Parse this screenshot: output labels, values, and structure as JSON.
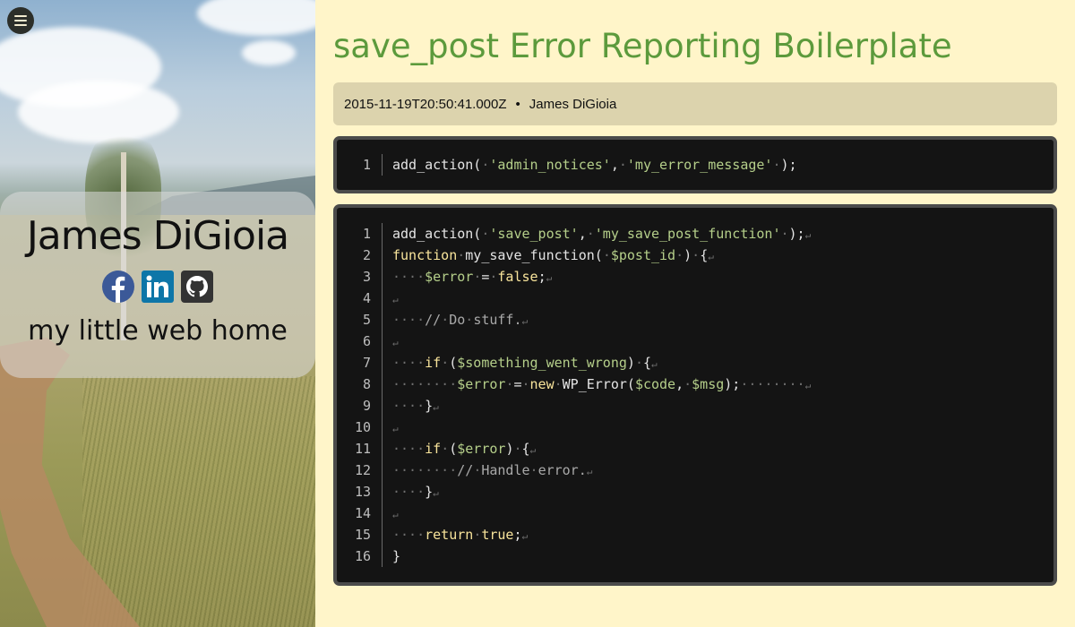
{
  "sidebar": {
    "name": "James DiGioia",
    "tagline": "my little web home",
    "socials": [
      {
        "icon": "facebook-icon",
        "color": "#3b5998"
      },
      {
        "icon": "linkedin-icon",
        "color": "#0e76a8"
      },
      {
        "icon": "github-icon",
        "color": "#333333"
      }
    ]
  },
  "post": {
    "title": "save_post Error Reporting Boilerplate",
    "date": "2015-11-19T20:50:41.000Z",
    "separator": "•",
    "author": "James DiGioia"
  },
  "code_blocks": [
    {
      "lines": [
        {
          "n": "1",
          "tokens": [
            [
              "p",
              "add_action("
            ],
            [
              "ws",
              "·"
            ],
            [
              "str",
              "'admin_notices'"
            ],
            [
              "p",
              ","
            ],
            [
              "ws",
              "·"
            ],
            [
              "str",
              "'my_error_message'"
            ],
            [
              "ws",
              "·"
            ],
            [
              "p",
              ");"
            ]
          ]
        }
      ]
    },
    {
      "lines": [
        {
          "n": "1",
          "tokens": [
            [
              "p",
              "add_action("
            ],
            [
              "ws",
              "·"
            ],
            [
              "str",
              "'save_post'"
            ],
            [
              "p",
              ","
            ],
            [
              "ws",
              "·"
            ],
            [
              "str",
              "'my_save_post_function'"
            ],
            [
              "ws",
              "·"
            ],
            [
              "p",
              ");"
            ],
            [
              "eol",
              "↵"
            ]
          ]
        },
        {
          "n": "2",
          "tokens": [
            [
              "kw",
              "function"
            ],
            [
              "ws",
              "·"
            ],
            [
              "p",
              "my_save_function("
            ],
            [
              "ws",
              "·"
            ],
            [
              "var",
              "$post_id"
            ],
            [
              "ws",
              "·"
            ],
            [
              "p",
              ")"
            ],
            [
              "ws",
              "·"
            ],
            [
              "p",
              "{"
            ],
            [
              "eol",
              "↵"
            ]
          ]
        },
        {
          "n": "3",
          "tokens": [
            [
              "ws",
              "····"
            ],
            [
              "var",
              "$error"
            ],
            [
              "ws",
              "·"
            ],
            [
              "p",
              "="
            ],
            [
              "ws",
              "·"
            ],
            [
              "kw",
              "false"
            ],
            [
              "p",
              ";"
            ],
            [
              "eol",
              "↵"
            ]
          ]
        },
        {
          "n": "4",
          "tokens": [
            [
              "eol",
              "↵"
            ]
          ]
        },
        {
          "n": "5",
          "tokens": [
            [
              "ws",
              "····"
            ],
            [
              "cm",
              "//"
            ],
            [
              "ws",
              "·"
            ],
            [
              "cm",
              "Do"
            ],
            [
              "ws",
              "·"
            ],
            [
              "cm",
              "stuff."
            ],
            [
              "eol",
              "↵"
            ]
          ]
        },
        {
          "n": "6",
          "tokens": [
            [
              "eol",
              "↵"
            ]
          ]
        },
        {
          "n": "7",
          "tokens": [
            [
              "ws",
              "····"
            ],
            [
              "kw",
              "if"
            ],
            [
              "ws",
              "·"
            ],
            [
              "p",
              "("
            ],
            [
              "var",
              "$something_went_wrong"
            ],
            [
              "p",
              ")"
            ],
            [
              "ws",
              "·"
            ],
            [
              "p",
              "{"
            ],
            [
              "eol",
              "↵"
            ]
          ]
        },
        {
          "n": "8",
          "tokens": [
            [
              "ws",
              "········"
            ],
            [
              "var",
              "$error"
            ],
            [
              "ws",
              "·"
            ],
            [
              "p",
              "="
            ],
            [
              "ws",
              "·"
            ],
            [
              "kw",
              "new"
            ],
            [
              "ws",
              "·"
            ],
            [
              "p",
              "WP_Error("
            ],
            [
              "var",
              "$code"
            ],
            [
              "p",
              ","
            ],
            [
              "ws",
              "·"
            ],
            [
              "var",
              "$msg"
            ],
            [
              "p",
              ");"
            ],
            [
              "ws",
              "········"
            ],
            [
              "eol",
              "↵"
            ]
          ]
        },
        {
          "n": "9",
          "tokens": [
            [
              "ws",
              "····"
            ],
            [
              "p",
              "}"
            ],
            [
              "eol",
              "↵"
            ]
          ]
        },
        {
          "n": "10",
          "tokens": [
            [
              "eol",
              "↵"
            ]
          ]
        },
        {
          "n": "11",
          "tokens": [
            [
              "ws",
              "····"
            ],
            [
              "kw",
              "if"
            ],
            [
              "ws",
              "·"
            ],
            [
              "p",
              "("
            ],
            [
              "var",
              "$error"
            ],
            [
              "p",
              ")"
            ],
            [
              "ws",
              "·"
            ],
            [
              "p",
              "{"
            ],
            [
              "eol",
              "↵"
            ]
          ]
        },
        {
          "n": "12",
          "tokens": [
            [
              "ws",
              "········"
            ],
            [
              "cm",
              "//"
            ],
            [
              "ws",
              "·"
            ],
            [
              "cm",
              "Handle"
            ],
            [
              "ws",
              "·"
            ],
            [
              "cm",
              "error."
            ],
            [
              "eol",
              "↵"
            ]
          ]
        },
        {
          "n": "13",
          "tokens": [
            [
              "ws",
              "····"
            ],
            [
              "p",
              "}"
            ],
            [
              "eol",
              "↵"
            ]
          ]
        },
        {
          "n": "14",
          "tokens": [
            [
              "eol",
              "↵"
            ]
          ]
        },
        {
          "n": "15",
          "tokens": [
            [
              "ws",
              "····"
            ],
            [
              "kw",
              "return"
            ],
            [
              "ws",
              "·"
            ],
            [
              "kw",
              "true"
            ],
            [
              "p",
              ";"
            ],
            [
              "eol",
              "↵"
            ]
          ]
        },
        {
          "n": "16",
          "tokens": [
            [
              "p",
              "}"
            ]
          ]
        }
      ]
    }
  ]
}
